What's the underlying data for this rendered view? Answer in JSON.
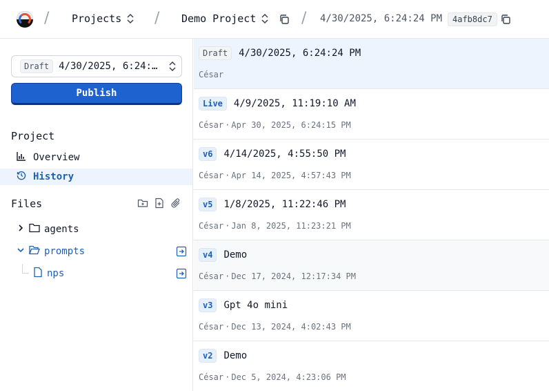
{
  "header": {
    "projects_label": "Projects",
    "project_name": "Demo Project",
    "version_date": "4/30/2025, 6:24:24 PM",
    "commit_hash": "4afb8dc7"
  },
  "sidebar": {
    "version_select": {
      "badge": "Draft",
      "value": "4/30/2025, 6:24:…"
    },
    "publish_label": "Publish",
    "project_section": "Project",
    "nav": [
      {
        "label": "Overview",
        "icon": "bar-chart-icon"
      },
      {
        "label": "History",
        "icon": "history-icon",
        "active": true
      }
    ],
    "files_section": "Files",
    "tree": [
      {
        "label": "agents",
        "type": "folder",
        "expanded": false
      },
      {
        "label": "prompts",
        "type": "folder",
        "expanded": true
      },
      {
        "label": "nps",
        "type": "file"
      }
    ]
  },
  "history": [
    {
      "badge": "Draft",
      "title": "4/30/2025, 6:24:24 PM",
      "author": "César",
      "date": ""
    },
    {
      "badge": "Live",
      "title": "4/9/2025, 11:19:10 AM",
      "author": "César",
      "date": "Apr 30, 2025, 6:24:15 PM"
    },
    {
      "badge": "v6",
      "title": "4/14/2025, 4:55:50 PM",
      "author": "César",
      "date": "Apr 14, 2025, 4:57:43 PM"
    },
    {
      "badge": "v5",
      "title": "1/8/2025, 11:22:46 PM",
      "author": "César",
      "date": "Jan 8, 2025, 11:23:21 PM"
    },
    {
      "badge": "v4",
      "title": "Demo",
      "author": "César",
      "date": "Dec 17, 2024, 12:17:34 PM"
    },
    {
      "badge": "v3",
      "title": "Gpt 4o mini",
      "author": "César",
      "date": "Dec 13, 2024, 4:02:43 PM"
    },
    {
      "badge": "v2",
      "title": "Demo",
      "author": "César",
      "date": "Dec 5, 2024, 4:23:06 PM"
    }
  ],
  "separator": "·",
  "colors": {
    "accent": "#1e62d0",
    "selected_bg": "#eef4fd",
    "badge_text": "#1d5fb8"
  }
}
